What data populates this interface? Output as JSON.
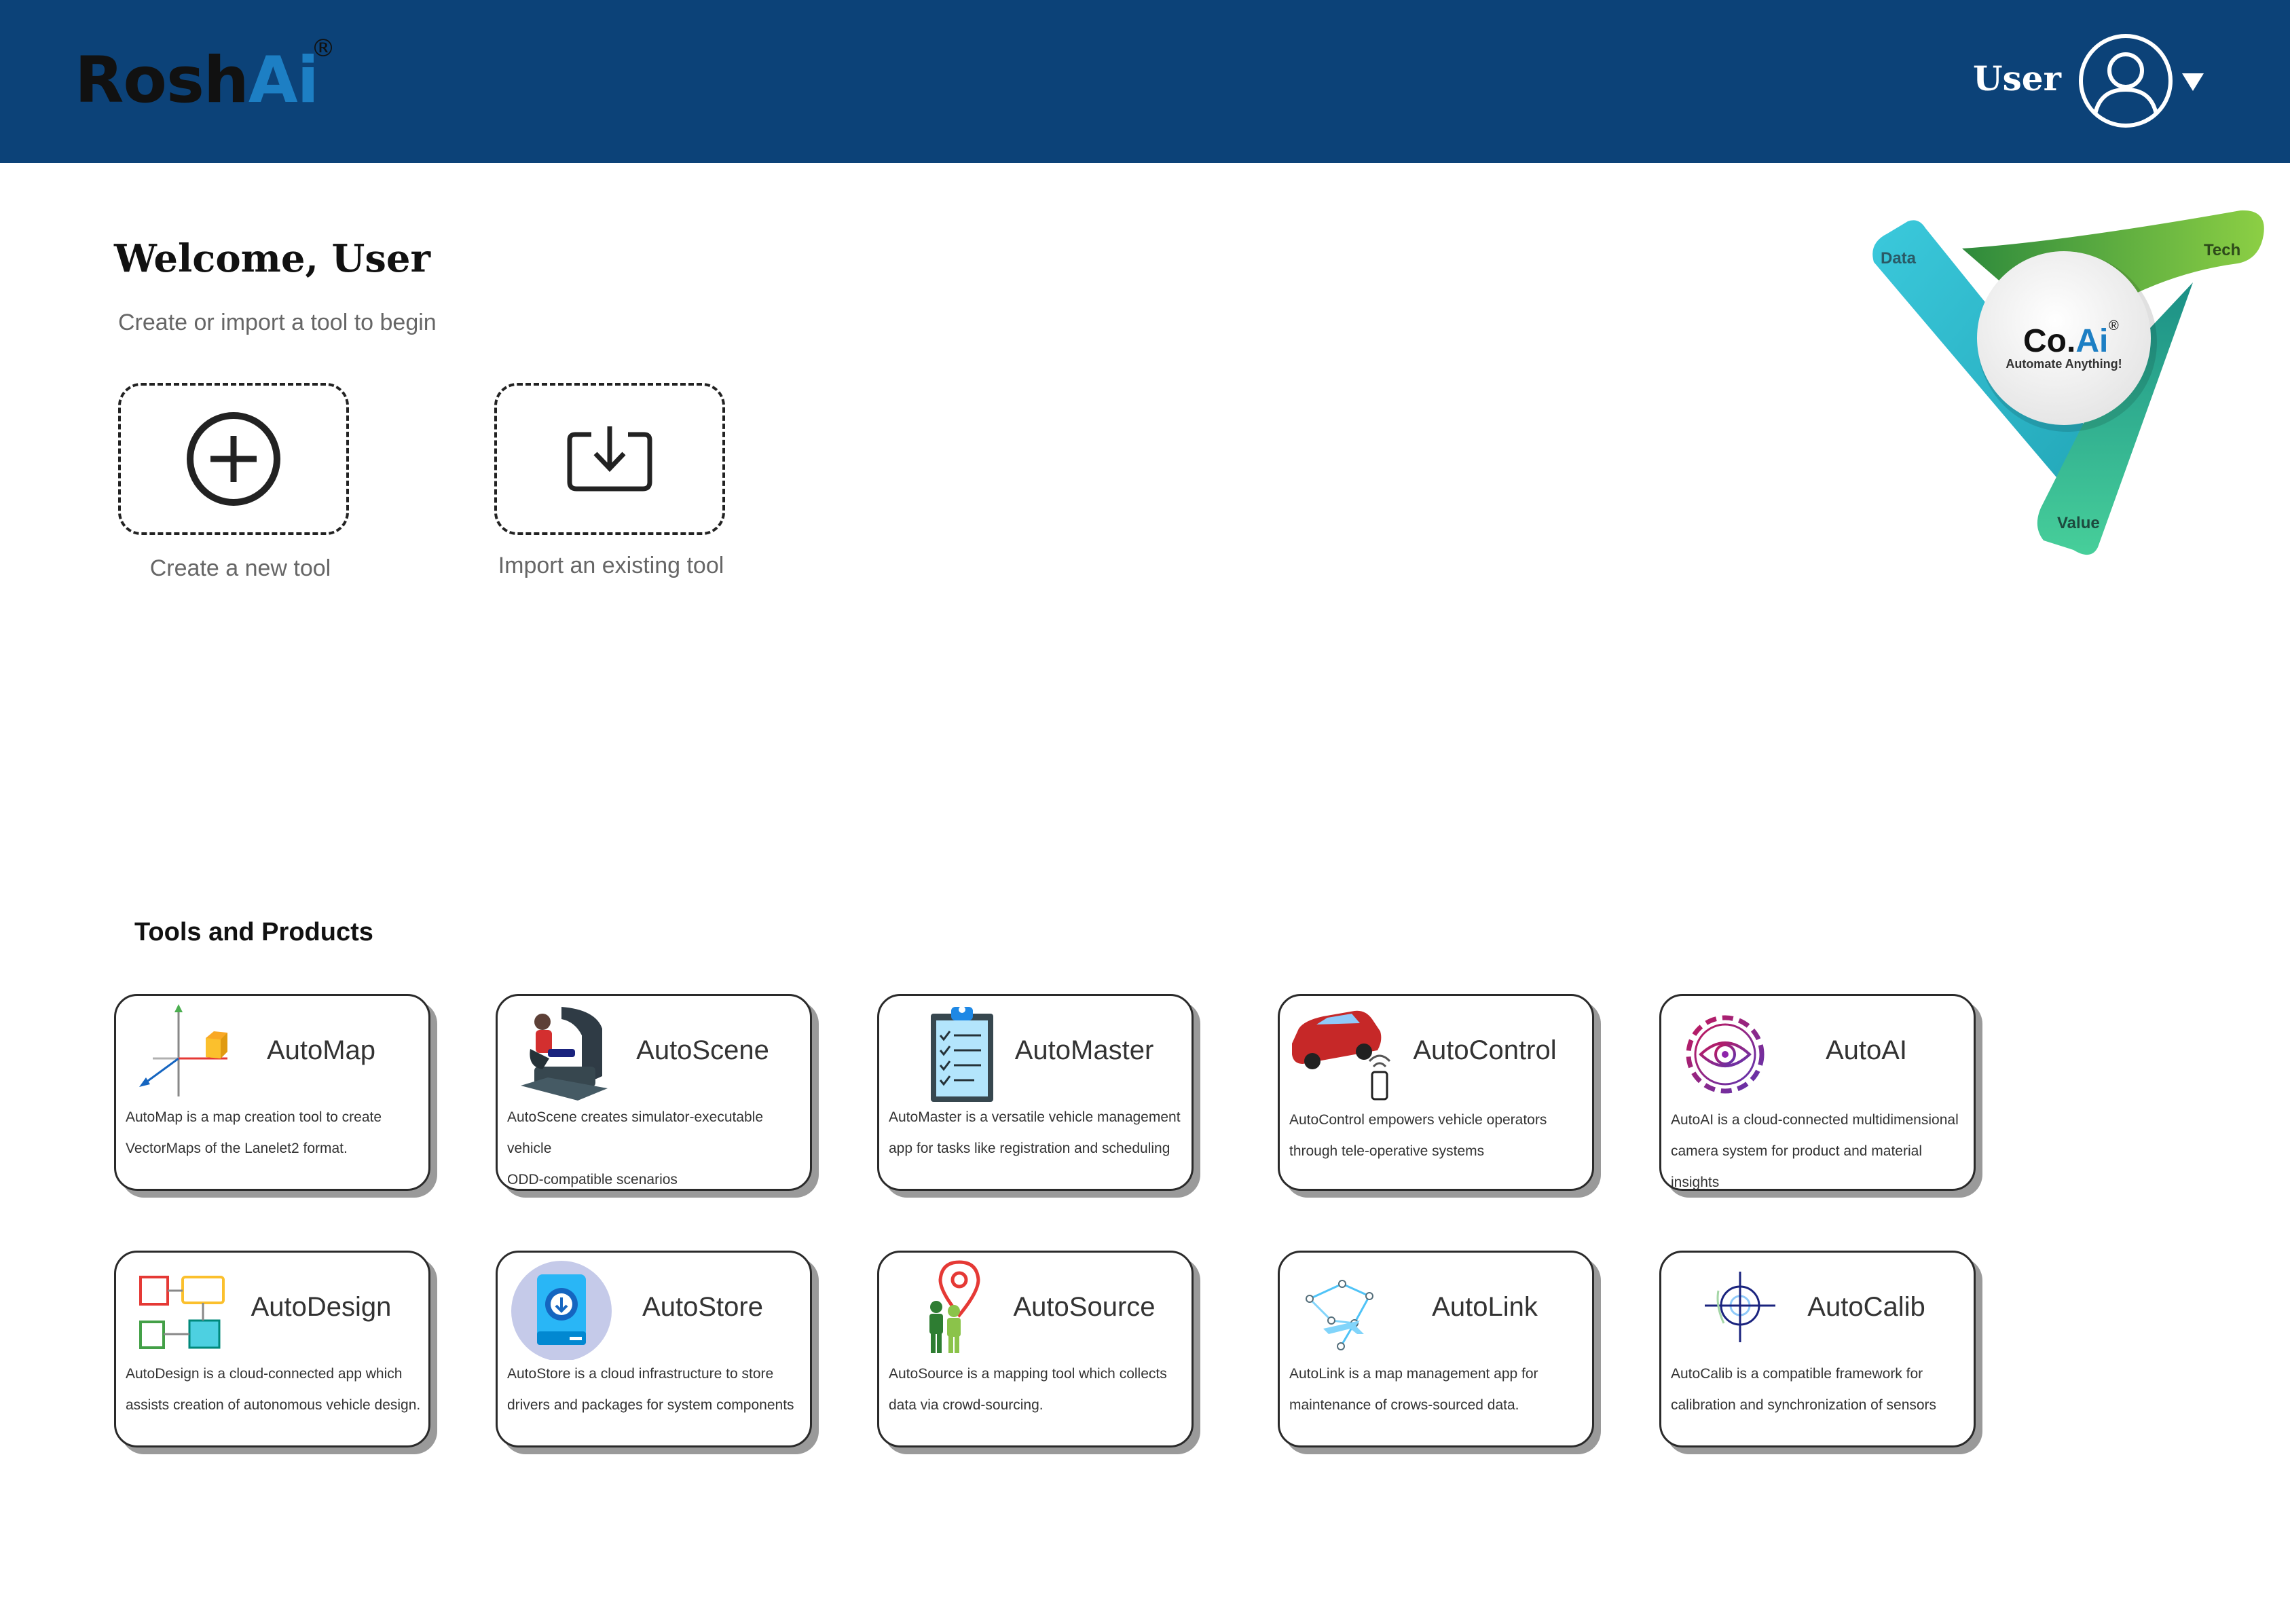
{
  "header": {
    "logo_part1": "Rosh",
    "logo_part2": "Ai",
    "logo_reg": "®",
    "user_label": "User",
    "brand_color": "#0c4278",
    "accent_color": "#1d7fc4"
  },
  "welcome": {
    "title": "Welcome, User",
    "subtitle": "Create or import a tool to begin"
  },
  "actions": {
    "create_label": "Create a new tool",
    "import_label": "Import an existing tool"
  },
  "coai": {
    "brand_co": "Co.",
    "brand_ai": "Ai",
    "reg": "®",
    "tagline": "Automate Anything!",
    "label_data": "Data",
    "label_tech": "Tech",
    "label_value": "Value"
  },
  "tools": {
    "section_title": "Tools and Products",
    "items": [
      {
        "name": "AutoMap",
        "icon": "axes-cube-icon",
        "line1": "AutoMap is a map creation tool to create",
        "line2": "VectorMaps of the Lanelet2 format."
      },
      {
        "name": "AutoScene",
        "icon": "simulator-driver-icon",
        "line1": "AutoScene creates simulator-executable vehicle",
        "line2": "ODD-compatible scenarios"
      },
      {
        "name": "AutoMaster",
        "icon": "clipboard-checklist-icon",
        "line1": "AutoMaster is a versatile vehicle management",
        "line2": "app for tasks like registration and scheduling"
      },
      {
        "name": "AutoControl",
        "icon": "car-remote-phone-icon",
        "line1": "AutoControl empowers vehicle operators",
        "line2": "through tele-operative systems"
      },
      {
        "name": "AutoAI",
        "icon": "gear-eye-icon",
        "line1": "AutoAI is a cloud-connected multidimensional",
        "line2": "camera system for product and material insights"
      },
      {
        "name": "AutoDesign",
        "icon": "flowchart-blocks-icon",
        "line1": "AutoDesign is a cloud-connected app which",
        "line2": "assists creation of  autonomous vehicle design."
      },
      {
        "name": "AutoStore",
        "icon": "storage-download-icon",
        "line1": "AutoStore is a cloud infrastructure to store",
        "line2": "drivers and packages for system components"
      },
      {
        "name": "AutoSource",
        "icon": "people-location-pin-icon",
        "line1": "AutoSource is a mapping tool which collects",
        "line2": "data via crowd-sourcing."
      },
      {
        "name": "AutoLink",
        "icon": "map-link-nodes-icon",
        "line1": "AutoLink is a map management app for",
        "line2": "maintenance of crows-sourced data."
      },
      {
        "name": "AutoCalib",
        "icon": "crosshair-target-icon",
        "line1": "AutoCalib is a compatible framework for",
        "line2": "calibration and synchronization of sensors"
      }
    ]
  }
}
